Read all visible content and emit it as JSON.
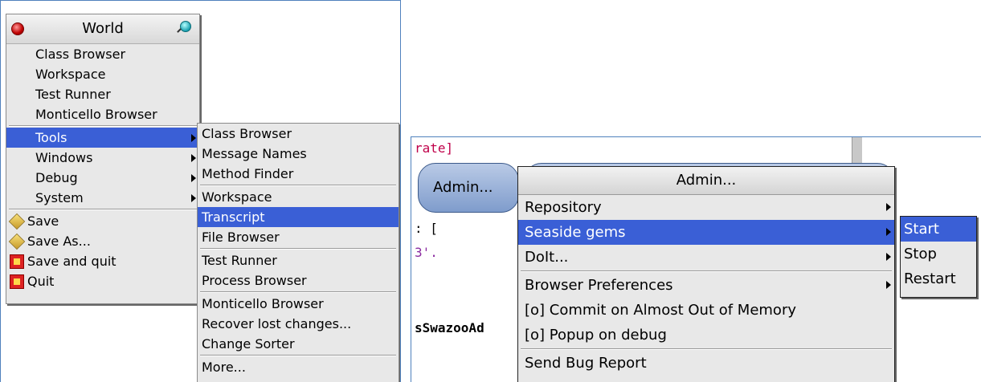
{
  "world_menu": {
    "title": "World",
    "items": [
      {
        "label": "Class Browser"
      },
      {
        "label": "Workspace"
      },
      {
        "label": "Test Runner"
      },
      {
        "label": "Monticello Browser"
      }
    ],
    "submenus": [
      {
        "label": "Tools",
        "selected": true
      },
      {
        "label": "Windows"
      },
      {
        "label": "Debug"
      },
      {
        "label": "System"
      }
    ],
    "actions": [
      {
        "label": "Save",
        "icon": "save-icon"
      },
      {
        "label": "Save As...",
        "icon": "save-as-icon"
      },
      {
        "label": "Save and quit",
        "icon": "save-and-quit-icon"
      },
      {
        "label": "Quit",
        "icon": "quit-icon"
      }
    ]
  },
  "tools_menu": {
    "group1": [
      "Class Browser",
      "Message Names",
      "Method Finder"
    ],
    "group2": [
      "Workspace",
      "Transcript",
      "File Browser"
    ],
    "selected": "Transcript",
    "group3": [
      "Test Runner",
      "Process Browser"
    ],
    "group4": [
      "Monticello Browser",
      "Recover lost changes...",
      "Change Sorter"
    ],
    "group5": [
      "More..."
    ]
  },
  "background_window": {
    "code_line1": "rate]",
    "code_line2": ": [",
    "code_line3": "3'.",
    "code_line4": "sSwazooAd",
    "button_label": "Admin..."
  },
  "admin_menu": {
    "title": "Admin...",
    "items": [
      {
        "label": "Repository",
        "submenu": true
      },
      {
        "label": "Seaside gems",
        "submenu": true,
        "selected": true
      },
      {
        "label": "DoIt...",
        "submenu": true
      },
      {
        "label": "Browser Preferences",
        "submenu": true
      },
      {
        "label": "[o] Commit on Almost Out of Memory"
      },
      {
        "label": "[o]  Popup on debug"
      },
      {
        "label": "Send Bug Report"
      }
    ]
  },
  "seaside_menu": {
    "items": [
      "Start",
      "Stop",
      "Restart"
    ],
    "selected": "Start"
  },
  "colors": {
    "selection": "#3a5fd6",
    "menu_bg": "#e8e8e8",
    "panel_border": "#4f81bd"
  }
}
